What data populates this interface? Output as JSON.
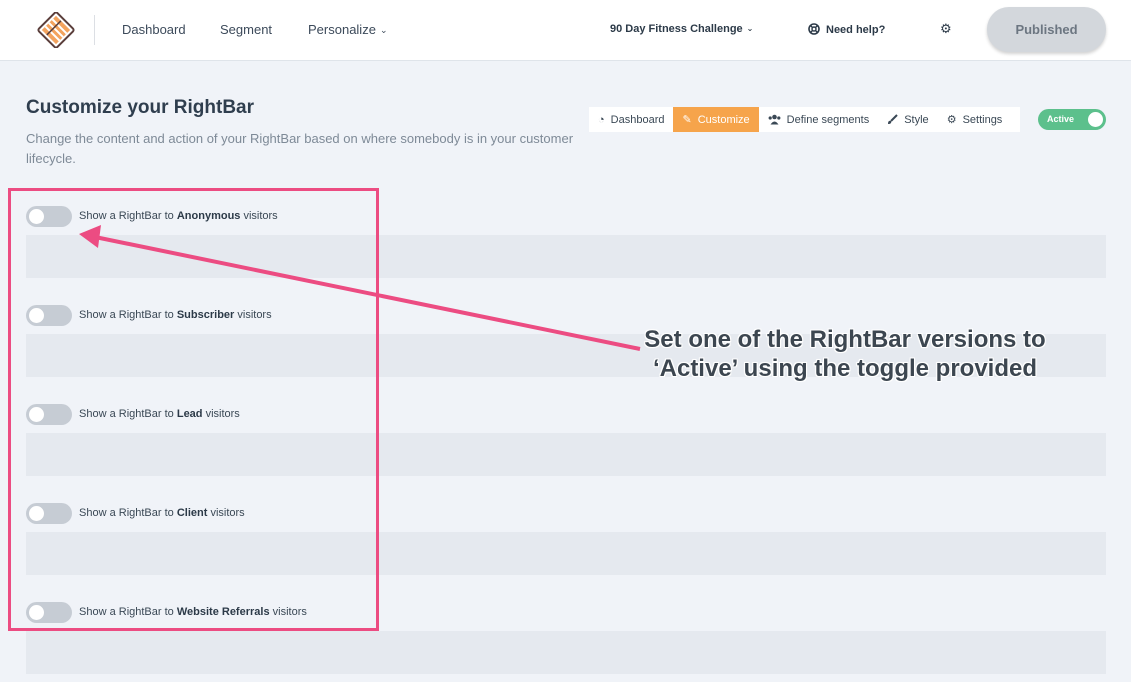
{
  "topnav": {
    "links": [
      {
        "label": "Dashboard"
      },
      {
        "label": "Segment"
      },
      {
        "label": "Personalize",
        "caret": "⌄"
      }
    ],
    "project": {
      "label": "90 Day Fitness Challenge",
      "caret": "⌄"
    },
    "help": {
      "label": "Need help?"
    },
    "gear_icon": "gear-icon",
    "publish_button": "Published"
  },
  "header": {
    "title": "Customize your RightBar",
    "description": "Change the content and action of your RightBar based on where somebody is in your customer lifecycle."
  },
  "tabs": [
    {
      "label": "Dashboard",
      "icon": "dashboard-icon",
      "active": false
    },
    {
      "label": "Customize",
      "icon": "pencil-icon",
      "active": true
    },
    {
      "label": "Define segments",
      "icon": "users-icon",
      "active": false
    },
    {
      "label": "Style",
      "icon": "brush-icon",
      "active": false
    },
    {
      "label": "Settings",
      "icon": "gear-icon",
      "active": false
    }
  ],
  "status_toggle": {
    "label": "Active",
    "on": true
  },
  "segments": [
    {
      "prefix": "Show a RightBar to ",
      "name": "Anonymous",
      "suffix": " visitors",
      "on": false
    },
    {
      "prefix": "Show a RightBar to ",
      "name": "Subscriber",
      "suffix": " visitors",
      "on": false
    },
    {
      "prefix": "Show a RightBar to ",
      "name": "Lead",
      "suffix": " visitors",
      "on": false
    },
    {
      "prefix": "Show a RightBar to ",
      "name": "Client",
      "suffix": " visitors",
      "on": false
    },
    {
      "prefix": "Show a RightBar to ",
      "name": "Website Referrals",
      "suffix": " visitors",
      "on": false
    }
  ],
  "annotation": {
    "line1": "Set one of the RightBar versions to",
    "line2": "‘Active’ using the toggle provided",
    "color": "#ec4c82"
  },
  "colors": {
    "accent_orange": "#f6a44b",
    "active_green": "#5cc08c",
    "highlight_pink": "#ec4c82"
  }
}
